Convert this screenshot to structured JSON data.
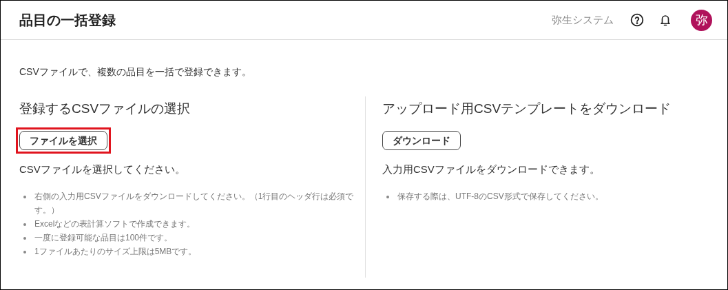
{
  "header": {
    "title": "品目の一括登録",
    "company": "弥生システム",
    "avatar": "弥"
  },
  "intro": "CSVファイルで、複数の品目を一括で登録できます。",
  "sections": [
    {
      "heading": "登録するCSVファイルの選択",
      "button": {
        "label": "ファイルを選択",
        "highlighted": true
      },
      "description": "CSVファイルを選択してください。",
      "notes": [
        "右側の入力用CSVファイルをダウンロードしてください。（1行目のヘッダ行は必須です。）",
        "Excelなどの表計算ソフトで作成できます。",
        "一度に登録可能な品目は100件です。",
        "1ファイルあたりのサイズ上限は5MBです。"
      ]
    },
    {
      "heading": "アップロード用CSVテンプレートをダウンロード",
      "button": {
        "label": "ダウンロード",
        "highlighted": false
      },
      "description": "入力用CSVファイルをダウンロードできます。",
      "notes": [
        "保存する際は、UTF-8のCSV形式で保存してください。"
      ]
    }
  ]
}
